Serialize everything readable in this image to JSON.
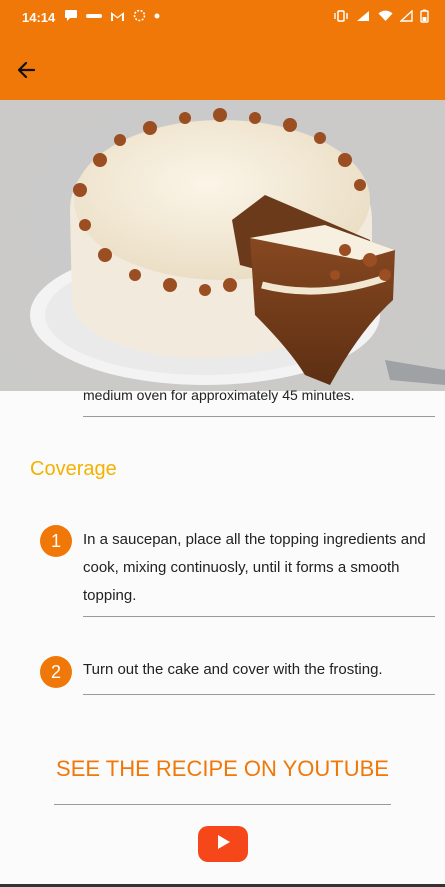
{
  "status_bar": {
    "time": "14:14"
  },
  "header": {
    "back_icon": "arrow-left-icon"
  },
  "hero": {
    "image_subject": "carrot cake with cream frosting and pecans"
  },
  "content": {
    "cut_text": "medium oven for approximately 45 minutes.",
    "section_title": "Coverage",
    "steps": [
      {
        "number": "1",
        "text": "In a saucepan, place all the topping ingredients and cook, mixing continuosly, until it forms a smooth topping."
      },
      {
        "number": "2",
        "text": "Turn out the cake and cover with the frosting."
      }
    ],
    "youtube_link": "SEE THE RECIPE ON YOUTUBE"
  },
  "colors": {
    "brand_orange": "#f07808",
    "section_title_yellow": "#f3b200",
    "youtube_red": "#f5471a"
  }
}
